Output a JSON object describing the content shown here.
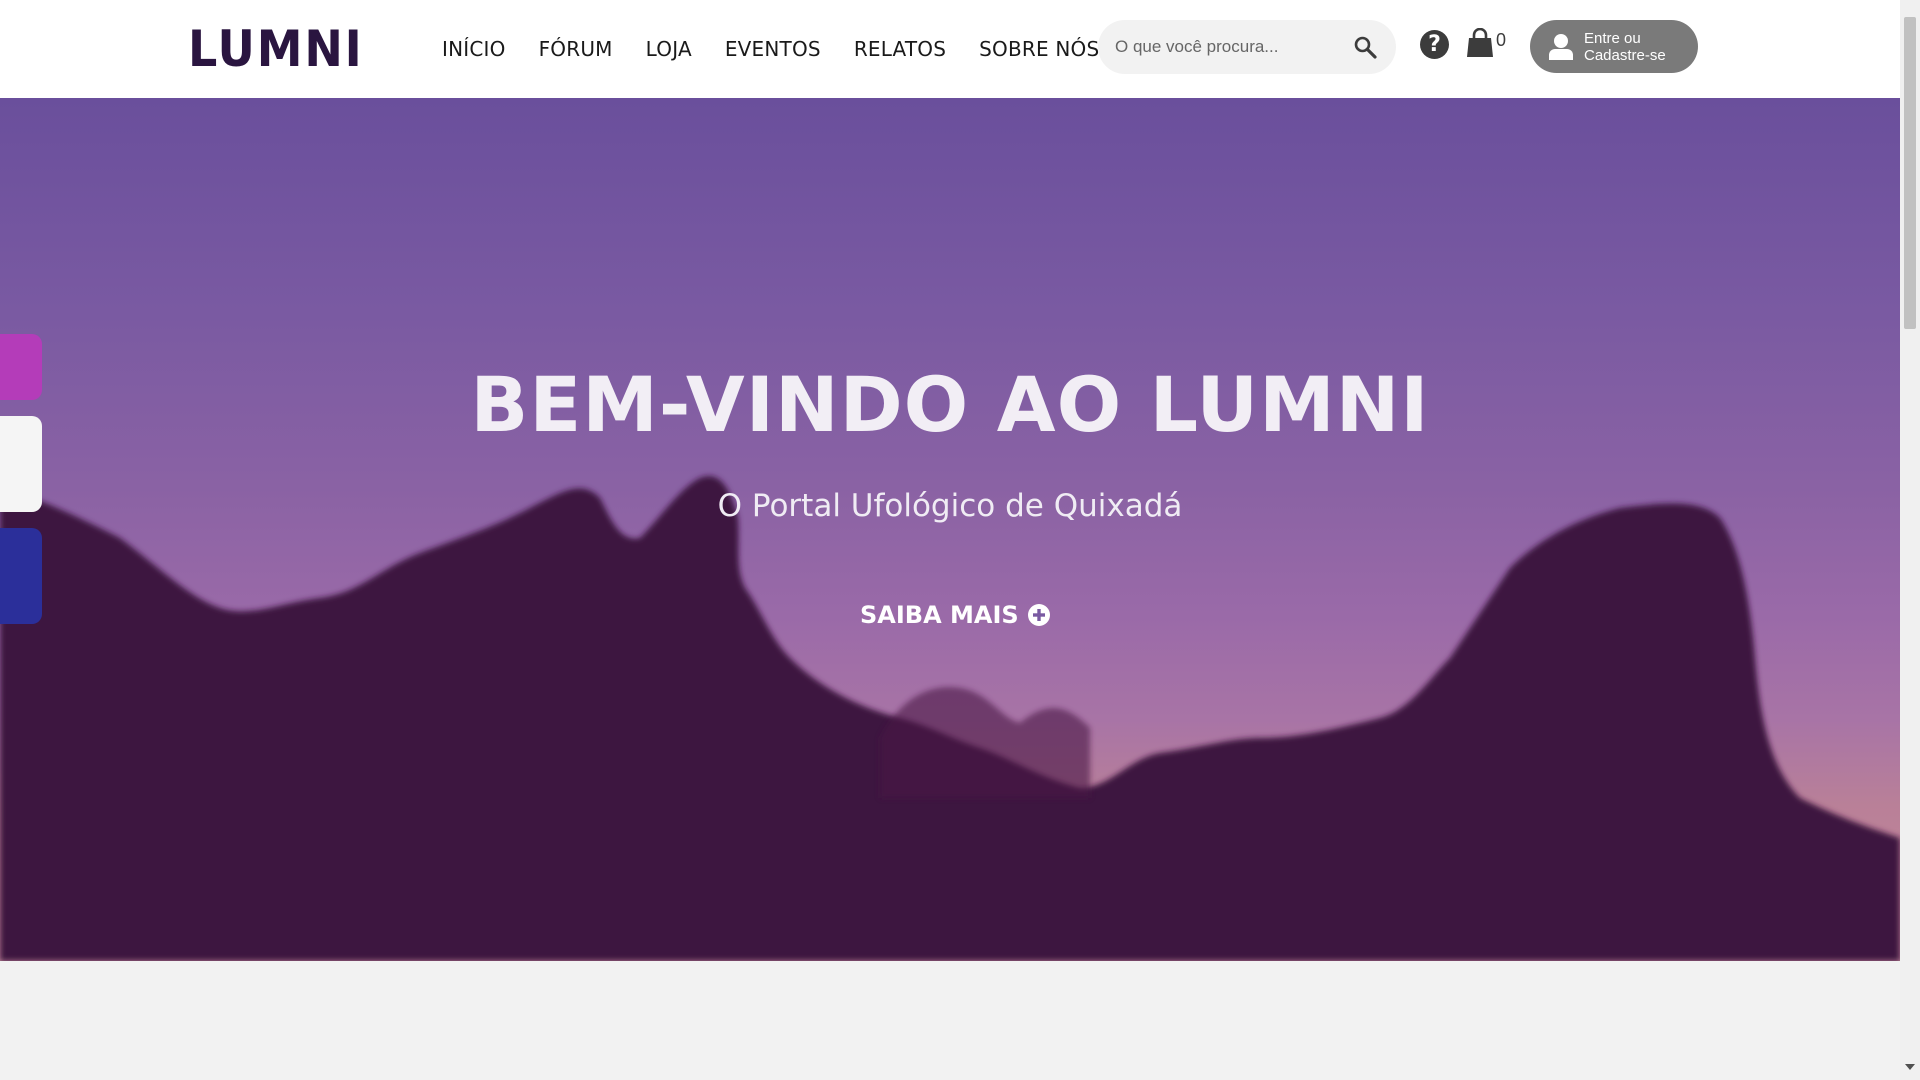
{
  "brand": {
    "name": "LUMNI"
  },
  "nav": {
    "items": [
      {
        "label": "INÍCIO"
      },
      {
        "label": "FÓRUM"
      },
      {
        "label": "LOJA"
      },
      {
        "label": "EVENTOS"
      },
      {
        "label": "RELATOS"
      },
      {
        "label": "SOBRE NÓS"
      }
    ]
  },
  "search": {
    "placeholder": "O que você procura...",
    "icon": "magnifier-icon"
  },
  "help": {
    "label": "?",
    "icon": "question-circle-icon"
  },
  "cart": {
    "count": "0",
    "icon": "shopping-bag-icon"
  },
  "login": {
    "line1": "Entre ou",
    "line2": "Cadastre-se",
    "icon": "user-icon"
  },
  "hero": {
    "title": "BEM-VINDO AO LUMNI",
    "subtitle": "O Portal Ufológico de Quixadá",
    "cta_label": "SAIBA MAIS",
    "cta_icon": "plus-circle-icon"
  },
  "colors": {
    "brand_dark": "#2a1540",
    "silhouette": "#3e1240",
    "tab_magenta": "#b43cb9",
    "tab_white": "#f5f5f5",
    "tab_blue": "#2b2f9a",
    "login_bg": "#7a7a7a"
  }
}
